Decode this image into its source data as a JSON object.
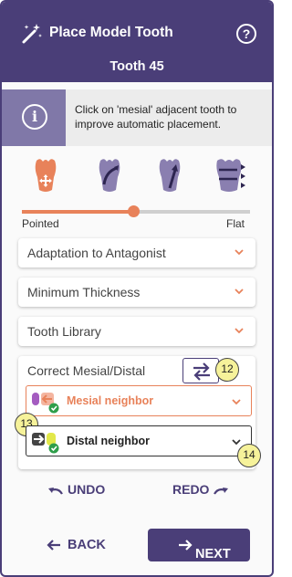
{
  "header": {
    "title": "Place Model Tooth",
    "subtitle": "Tooth 45",
    "help_icon": "question-circle-icon",
    "title_icon": "magic-wand-icon"
  },
  "info": {
    "icon": "info-circle-icon",
    "message": "Click on 'mesial' adjacent tooth to improve automatic placement."
  },
  "tools": [
    {
      "name": "move-tooth-tool",
      "active": true
    },
    {
      "name": "rotate-tooth-tool",
      "active": false
    },
    {
      "name": "tilt-tooth-tool",
      "active": false
    },
    {
      "name": "scale-tooth-tool",
      "active": false
    }
  ],
  "shape_slider": {
    "left_label": "Pointed",
    "right_label": "Flat",
    "value_fraction": 0.49
  },
  "sections": [
    {
      "label": "Adaptation to Antagonist"
    },
    {
      "label": "Minimum Thickness"
    },
    {
      "label": "Tooth Library"
    }
  ],
  "mesial_distal": {
    "label": "Correct Mesial/Distal",
    "swap_icon": "swap-arrows-icon",
    "mesial_neighbor": "Mesial neighbor",
    "distal_neighbor": "Distal neighbor"
  },
  "callouts": [
    "12",
    "13",
    "14"
  ],
  "footer": {
    "undo": "UNDO",
    "redo": "REDO",
    "back": "BACK",
    "next": "NEXT"
  },
  "colors": {
    "primary": "#4a3e78",
    "accent": "#e8825a",
    "info_box": "#8078a8",
    "success": "#2e9e4a"
  }
}
